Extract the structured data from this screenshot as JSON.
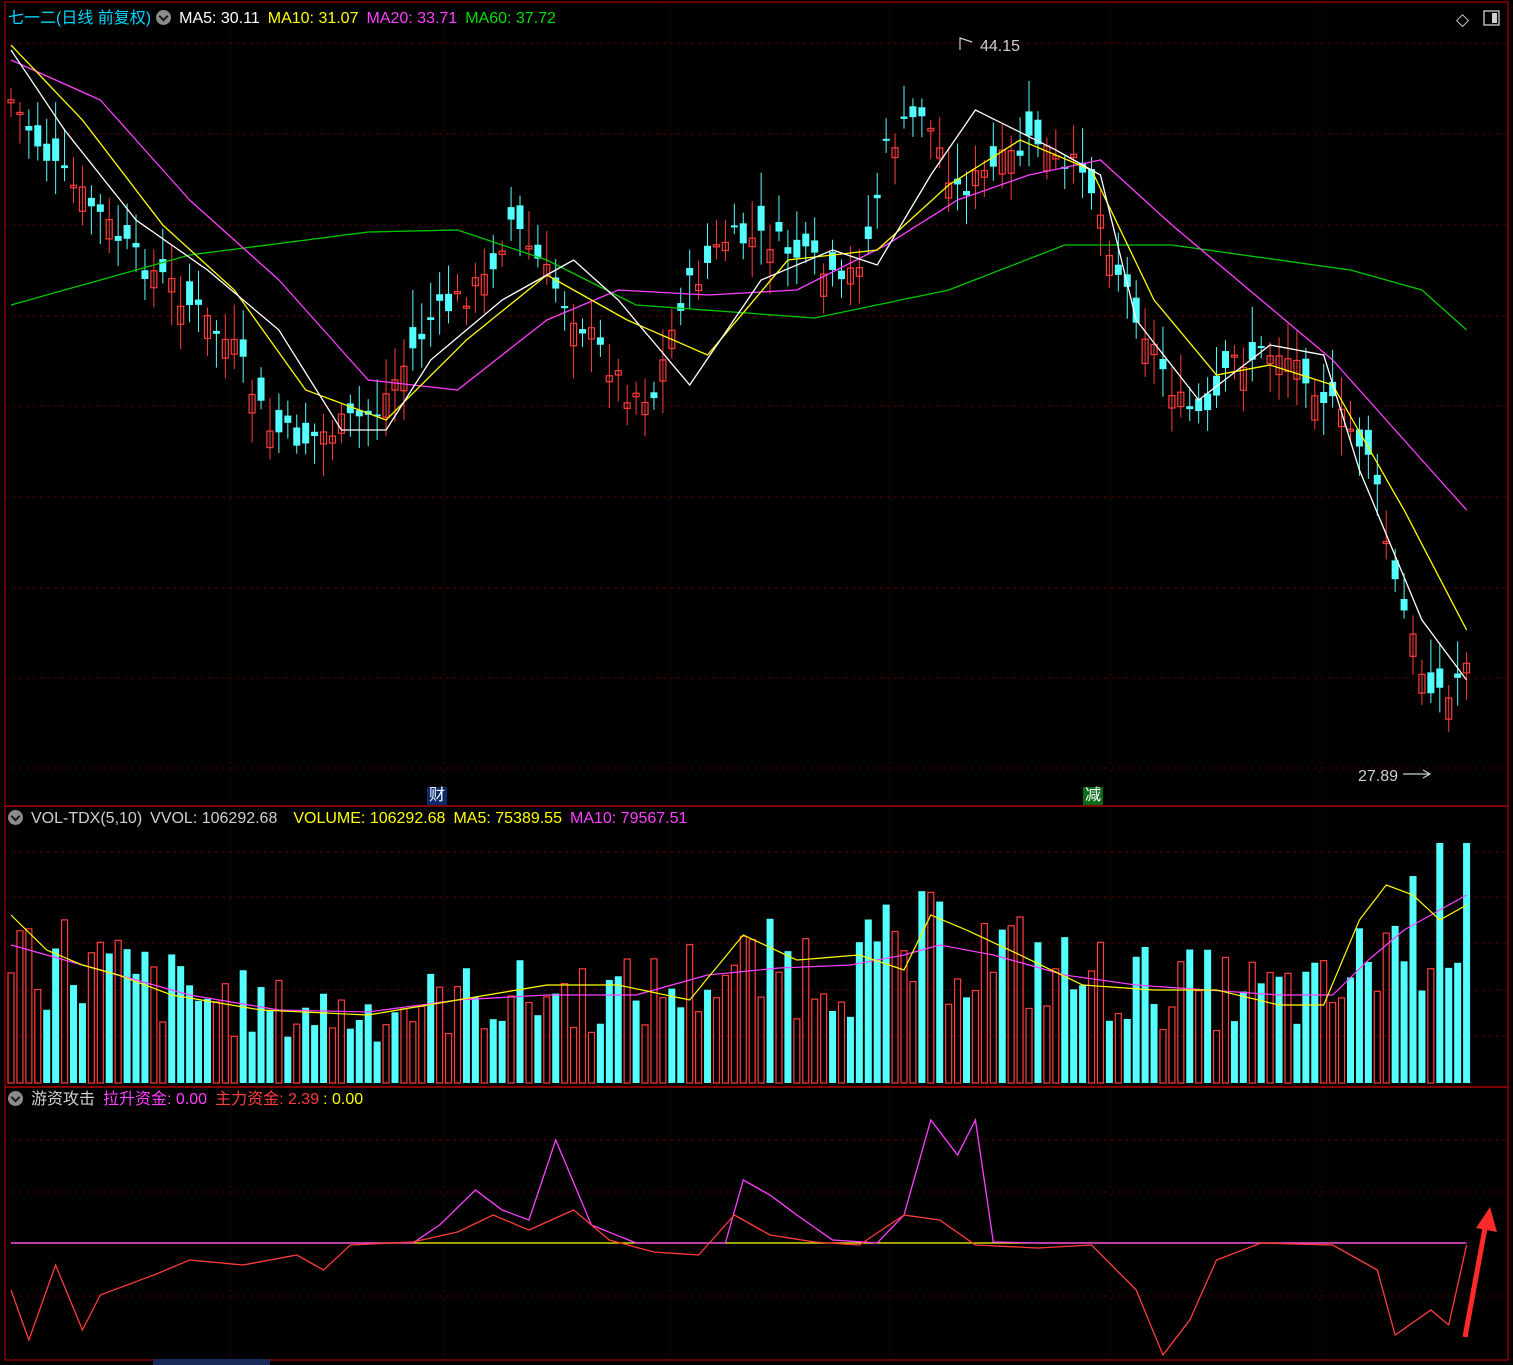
{
  "header": {
    "stock_title": "七一二(日线 前复权)",
    "ma5": "MA5: 30.11",
    "ma10": "MA10: 31.07",
    "ma20": "MA20: 33.71",
    "ma60": "MA60: 37.72",
    "icons": [
      "diamond-icon",
      "panel-toggle-icon"
    ]
  },
  "volume_header": {
    "name": "VOL-TDX(5,10)",
    "vvol": "VVOL: 106292.68",
    "volume": "VOLUME: 106292.68",
    "ma5": "MA5: 75389.55",
    "ma10": "MA10: 79567.51"
  },
  "indicator_header": {
    "name": "游资攻击",
    "lasheng": "拉升资金: 0.00",
    "zhuli": "主力资金: 2.39",
    "extra": ": 0.00"
  },
  "annotations": {
    "high_label": "44.15",
    "low_label": "27.89",
    "event_cai": "财",
    "event_jian": "减"
  },
  "colors": {
    "up": "#ff3c3c",
    "down": "#54ffff",
    "ma5": "#ffffff",
    "ma10": "#ffff00",
    "ma20": "#ff40ff",
    "ma60": "#00c800",
    "grid": "#7a0000",
    "baseline": "#ffff00",
    "arrow": "#ff2a2a"
  },
  "chart_data": [
    {
      "type": "candlestick",
      "price_range": [
        27.3,
        45.2
      ],
      "high_marker": 44.15,
      "low_marker": 27.89,
      "ma_periods": [
        5,
        10,
        20,
        60
      ],
      "last_ma_values": {
        "MA5": 30.11,
        "MA10": 31.07,
        "MA20": 33.71,
        "MA60": 37.72
      }
    },
    {
      "type": "bar",
      "series": [
        {
          "name": "VOLUME",
          "last": 106292.68
        },
        {
          "name": "MA5",
          "last": 75389.55
        },
        {
          "name": "MA10",
          "last": 79567.51
        }
      ]
    },
    {
      "type": "line",
      "series": [
        {
          "name": "拉升资金",
          "last": 0.0
        },
        {
          "name": "主力资金",
          "last": 2.39
        }
      ]
    }
  ]
}
